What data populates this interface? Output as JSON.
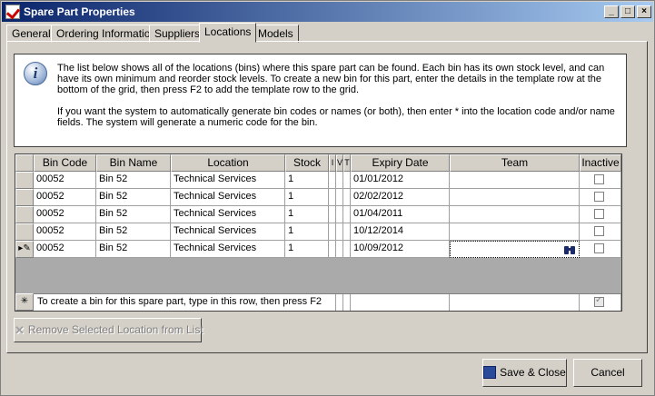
{
  "window": {
    "title": "Spare Part Properties"
  },
  "tabs": [
    {
      "label": "General"
    },
    {
      "label": "Ordering Information"
    },
    {
      "label": "Suppliers"
    },
    {
      "label": "Locations"
    },
    {
      "label": "Models"
    }
  ],
  "info": {
    "paragraph1": "The list below shows all of the locations (bins) where this spare part can be found. Each bin has its own stock level, and can have its own minimum and reorder stock levels. To create a new bin for this part, enter the details in the template row at the bottom of the grid, then press F2 to add the template row to the grid.",
    "paragraph2": "If you want the system to automatically generate bin codes or names (or both), then enter * into the location code and/or name fields. The system will generate a numeric code for the bin."
  },
  "grid": {
    "headers": {
      "bin_code": "Bin Code",
      "bin_name": "Bin Name",
      "location": "Location",
      "stock": "Stock",
      "c1": "I",
      "c2": "V",
      "c3": "T",
      "expiry": "Expiry Date",
      "team": "Team",
      "inactive": "Inactive"
    },
    "rows": [
      {
        "bin_code": "00052",
        "bin_name": "Bin 52",
        "location": "Technical Services",
        "stock": "1",
        "expiry": "01/01/2012",
        "team": "",
        "inactive": false
      },
      {
        "bin_code": "00052",
        "bin_name": "Bin 52",
        "location": "Technical Services",
        "stock": "1",
        "expiry": "02/02/2012",
        "team": "",
        "inactive": false
      },
      {
        "bin_code": "00052",
        "bin_name": "Bin 52",
        "location": "Technical Services",
        "stock": "1",
        "expiry": "01/04/2011",
        "team": "",
        "inactive": false
      },
      {
        "bin_code": "00052",
        "bin_name": "Bin 52",
        "location": "Technical Services",
        "stock": "1",
        "expiry": "10/12/2014",
        "team": "",
        "inactive": false
      },
      {
        "bin_code": "00052",
        "bin_name": "Bin 52",
        "location": "Technical Services",
        "stock": "1",
        "expiry": "10/09/2012",
        "team": "",
        "inactive": false
      }
    ],
    "new_row_text": "To create a bin for this spare part, type in this row, then press F2"
  },
  "buttons": {
    "remove_location": "Remove Selected Location from List",
    "save_close": "Save & Close",
    "cancel": "Cancel"
  }
}
